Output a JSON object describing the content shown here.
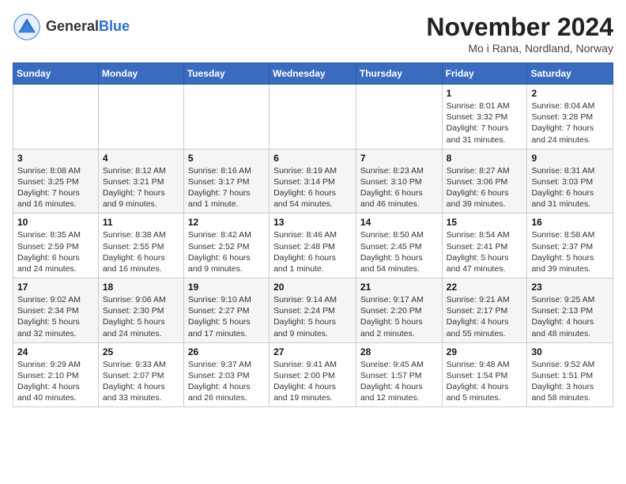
{
  "header": {
    "logo_general": "General",
    "logo_blue": "Blue",
    "title": "November 2024",
    "location": "Mo i Rana, Nordland, Norway"
  },
  "days_of_week": [
    "Sunday",
    "Monday",
    "Tuesday",
    "Wednesday",
    "Thursday",
    "Friday",
    "Saturday"
  ],
  "weeks": [
    [
      {
        "day": "",
        "info": ""
      },
      {
        "day": "",
        "info": ""
      },
      {
        "day": "",
        "info": ""
      },
      {
        "day": "",
        "info": ""
      },
      {
        "day": "",
        "info": ""
      },
      {
        "day": "1",
        "info": "Sunrise: 8:01 AM\nSunset: 3:32 PM\nDaylight: 7 hours and 31 minutes."
      },
      {
        "day": "2",
        "info": "Sunrise: 8:04 AM\nSunset: 3:28 PM\nDaylight: 7 hours and 24 minutes."
      }
    ],
    [
      {
        "day": "3",
        "info": "Sunrise: 8:08 AM\nSunset: 3:25 PM\nDaylight: 7 hours and 16 minutes."
      },
      {
        "day": "4",
        "info": "Sunrise: 8:12 AM\nSunset: 3:21 PM\nDaylight: 7 hours and 9 minutes."
      },
      {
        "day": "5",
        "info": "Sunrise: 8:16 AM\nSunset: 3:17 PM\nDaylight: 7 hours and 1 minute."
      },
      {
        "day": "6",
        "info": "Sunrise: 8:19 AM\nSunset: 3:14 PM\nDaylight: 6 hours and 54 minutes."
      },
      {
        "day": "7",
        "info": "Sunrise: 8:23 AM\nSunset: 3:10 PM\nDaylight: 6 hours and 46 minutes."
      },
      {
        "day": "8",
        "info": "Sunrise: 8:27 AM\nSunset: 3:06 PM\nDaylight: 6 hours and 39 minutes."
      },
      {
        "day": "9",
        "info": "Sunrise: 8:31 AM\nSunset: 3:03 PM\nDaylight: 6 hours and 31 minutes."
      }
    ],
    [
      {
        "day": "10",
        "info": "Sunrise: 8:35 AM\nSunset: 2:59 PM\nDaylight: 6 hours and 24 minutes."
      },
      {
        "day": "11",
        "info": "Sunrise: 8:38 AM\nSunset: 2:55 PM\nDaylight: 6 hours and 16 minutes."
      },
      {
        "day": "12",
        "info": "Sunrise: 8:42 AM\nSunset: 2:52 PM\nDaylight: 6 hours and 9 minutes."
      },
      {
        "day": "13",
        "info": "Sunrise: 8:46 AM\nSunset: 2:48 PM\nDaylight: 6 hours and 1 minute."
      },
      {
        "day": "14",
        "info": "Sunrise: 8:50 AM\nSunset: 2:45 PM\nDaylight: 5 hours and 54 minutes."
      },
      {
        "day": "15",
        "info": "Sunrise: 8:54 AM\nSunset: 2:41 PM\nDaylight: 5 hours and 47 minutes."
      },
      {
        "day": "16",
        "info": "Sunrise: 8:58 AM\nSunset: 2:37 PM\nDaylight: 5 hours and 39 minutes."
      }
    ],
    [
      {
        "day": "17",
        "info": "Sunrise: 9:02 AM\nSunset: 2:34 PM\nDaylight: 5 hours and 32 minutes."
      },
      {
        "day": "18",
        "info": "Sunrise: 9:06 AM\nSunset: 2:30 PM\nDaylight: 5 hours and 24 minutes."
      },
      {
        "day": "19",
        "info": "Sunrise: 9:10 AM\nSunset: 2:27 PM\nDaylight: 5 hours and 17 minutes."
      },
      {
        "day": "20",
        "info": "Sunrise: 9:14 AM\nSunset: 2:24 PM\nDaylight: 5 hours and 9 minutes."
      },
      {
        "day": "21",
        "info": "Sunrise: 9:17 AM\nSunset: 2:20 PM\nDaylight: 5 hours and 2 minutes."
      },
      {
        "day": "22",
        "info": "Sunrise: 9:21 AM\nSunset: 2:17 PM\nDaylight: 4 hours and 55 minutes."
      },
      {
        "day": "23",
        "info": "Sunrise: 9:25 AM\nSunset: 2:13 PM\nDaylight: 4 hours and 48 minutes."
      }
    ],
    [
      {
        "day": "24",
        "info": "Sunrise: 9:29 AM\nSunset: 2:10 PM\nDaylight: 4 hours and 40 minutes."
      },
      {
        "day": "25",
        "info": "Sunrise: 9:33 AM\nSunset: 2:07 PM\nDaylight: 4 hours and 33 minutes."
      },
      {
        "day": "26",
        "info": "Sunrise: 9:37 AM\nSunset: 2:03 PM\nDaylight: 4 hours and 26 minutes."
      },
      {
        "day": "27",
        "info": "Sunrise: 9:41 AM\nSunset: 2:00 PM\nDaylight: 4 hours and 19 minutes."
      },
      {
        "day": "28",
        "info": "Sunrise: 9:45 AM\nSunset: 1:57 PM\nDaylight: 4 hours and 12 minutes."
      },
      {
        "day": "29",
        "info": "Sunrise: 9:48 AM\nSunset: 1:54 PM\nDaylight: 4 hours and 5 minutes."
      },
      {
        "day": "30",
        "info": "Sunrise: 9:52 AM\nSunset: 1:51 PM\nDaylight: 3 hours and 58 minutes."
      }
    ]
  ]
}
